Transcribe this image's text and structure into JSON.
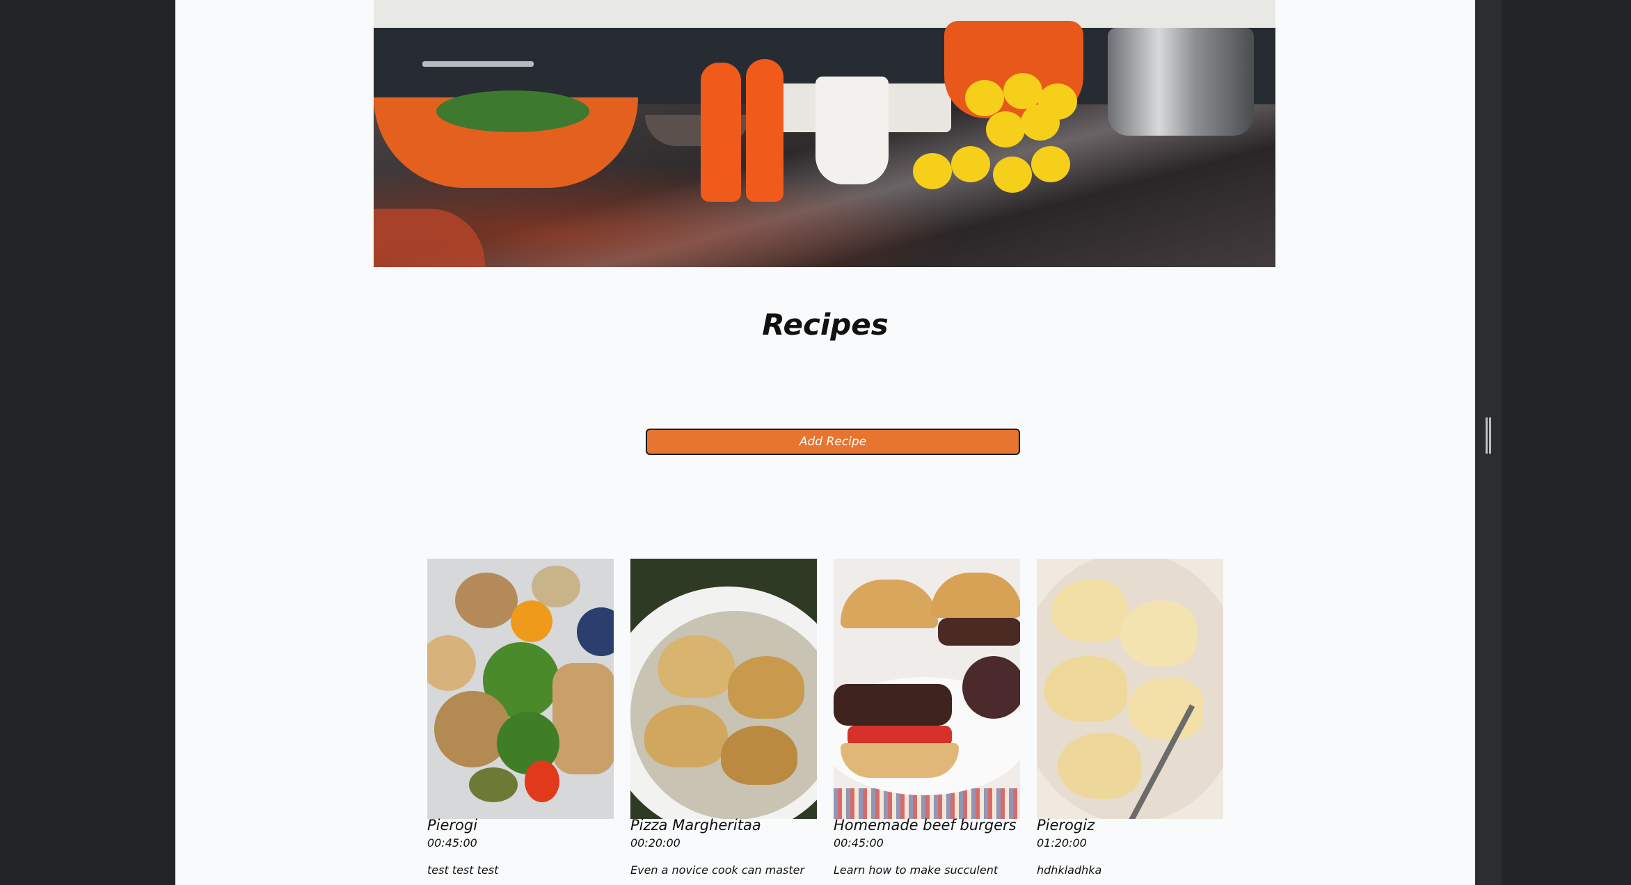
{
  "page": {
    "title": "Recipes",
    "add_button_label": "Add Recipe"
  },
  "hero": {
    "alt": "kitchen-counter-photo"
  },
  "recipes": [
    {
      "name": "Pierogi",
      "time": "00:45:00",
      "description": "test test test"
    },
    {
      "name": "Pizza Margheritaa",
      "time": "00:20:00",
      "description": "Even a novice cook can master"
    },
    {
      "name": "Homemade beef burgers",
      "time": "00:45:00",
      "description": "Learn how to make succulent"
    },
    {
      "name": "Pierogiz",
      "time": "01:20:00",
      "description": "hdhkladhka"
    }
  ],
  "colors": {
    "accent": "#e7742f",
    "background": "#f9fafb",
    "outer": "#232425"
  }
}
